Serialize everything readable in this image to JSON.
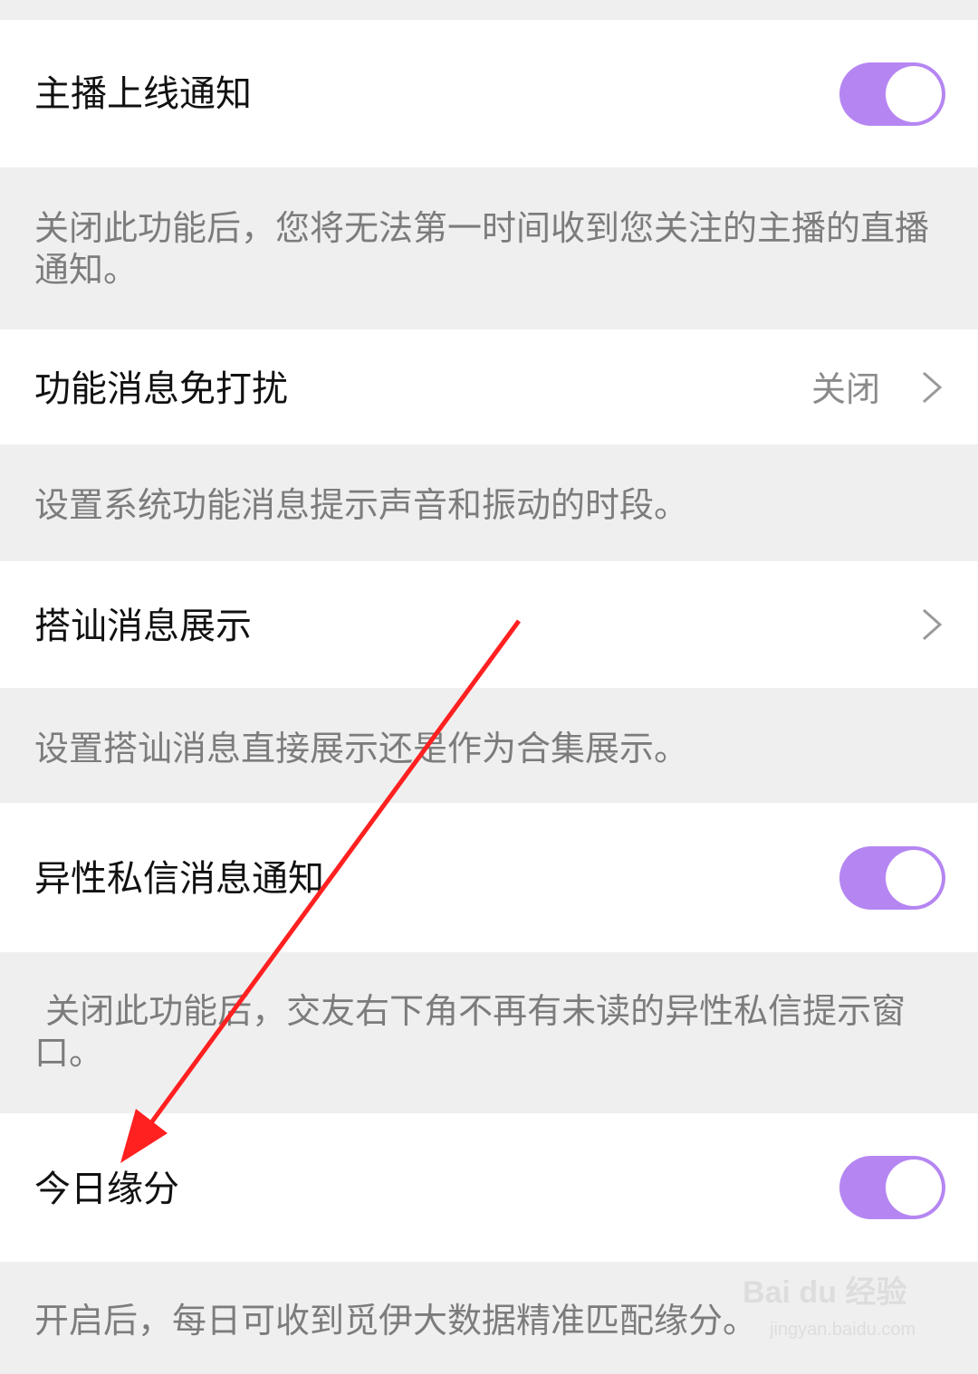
{
  "settings": [
    {
      "title": "主播上线通知",
      "type": "toggle",
      "on": true,
      "description": "关闭此功能后，您将无法第一时间收到您关注的主播的直播通知。"
    },
    {
      "title": "功能消息免打扰",
      "type": "link",
      "value": "关闭",
      "description": "设置系统功能消息提示声音和振动的时段。"
    },
    {
      "title": "搭讪消息展示",
      "type": "link",
      "description": "设置搭讪消息直接展示还是作为合集展示。"
    },
    {
      "title": "异性私信消息通知",
      "type": "toggle",
      "on": true,
      "description": " 关闭此功能后，交友右下角不再有未读的异性私信提示窗口。"
    },
    {
      "title": "今日缘分",
      "type": "toggle",
      "on": true,
      "description": "开启后，每日可收到觅伊大数据精准匹配缘分。"
    }
  ],
  "colors": {
    "toggle_on": "#b586f2",
    "arrow": "#ff2020",
    "background": "#efefef"
  },
  "watermark": {
    "brand": "Bai du 经验",
    "url": "jingyan.baidu.com"
  }
}
